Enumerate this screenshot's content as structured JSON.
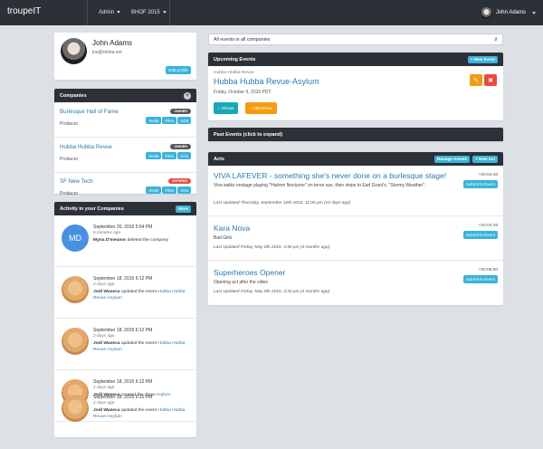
{
  "nav": {
    "brand": "troupeIT",
    "menu1": "Admin",
    "menu2": "BHOF 2015",
    "user": "John Adams"
  },
  "profile": {
    "name": "John Adams",
    "email": "jna@retina.net",
    "edit": "Edit profile"
  },
  "companies": {
    "title": "Companies",
    "items": [
      {
        "name": "Burlesque Hall of Fame",
        "role": "Producer",
        "badge": "OWNER",
        "badge_color": "#555555",
        "btn1": "Invite",
        "btn2": "Files",
        "btn3": "Acts"
      },
      {
        "name": "Hubba Hubba Revue",
        "role": "Producer",
        "badge": "OWNER",
        "badge_color": "#555555",
        "btn1": "Invite",
        "btn2": "Files",
        "btn3": "Acts"
      },
      {
        "name": "SF New Tech",
        "role": "Producer",
        "badge": "EXPIRED",
        "badge_color": "#e74c3c",
        "btn1": "Invite",
        "btn2": "Files",
        "btn3": "Acts"
      }
    ]
  },
  "activity": {
    "title": "Activity in your Companies",
    "more": "More",
    "items": [
      {
        "initials": "MD",
        "timestamp": "September 20, 2015 5:54 PM",
        "ago": "8 minutes ago",
        "actor": "Myna D'meanor",
        "action": " deleted the company",
        "link": ""
      },
      {
        "initials": "",
        "timestamp": "September 18, 2015 6:12 PM",
        "ago": "2 days ago",
        "actor": "Jodi Waseca",
        "action": " updated the event ",
        "link": "Hubba Hubba Revue-Asylum"
      },
      {
        "initials": "",
        "timestamp": "September 18, 2015 6:12 PM",
        "ago": "2 days ago",
        "actor": "Jodi Waseca",
        "action": " updated the event ",
        "link": "Hubba Hubba Revue-Asylum"
      },
      {
        "initials": "",
        "timestamp": "September 18, 2015 6:12 PM",
        "ago": "2 days ago",
        "actor": "Jodi Waseca",
        "action": " created the show ",
        "link": "Asylum"
      },
      {
        "initials": "",
        "timestamp": "September 18, 2015 6:10 PM",
        "ago": "2 days ago",
        "actor": "Jodi Waseca",
        "action": " updated the event ",
        "link": "Hubba Hubba Revue-Asylum"
      }
    ]
  },
  "filter": {
    "selected": "All events in all companies"
  },
  "upcoming": {
    "title": "Upcoming Events",
    "new_event": "+ New Event",
    "company": "Hubba Hubba Revue",
    "event": "Hubba Hubba Revue-Asylum",
    "date": "Friday, October 9, 2015 PDT",
    "shows": "Shows",
    "add_show": "+ Add Show"
  },
  "past": {
    "title": "Past Events (click to expand)"
  },
  "acts": {
    "title": "Acts",
    "manage_assets": "Manage Assets",
    "new_act": "+ New Act",
    "submit": "Submit to Event",
    "items": [
      {
        "title": "VIVA LAFEVER - something she's never done on a burlesque stage!",
        "desc": "Viva walks onstage playing \"Harlem Nocturne\" on tenor sax, then strips to Earl Grant's, \"Stormy Weather\".",
        "duration": "+00:02:46",
        "updated": "Last Updated Thursday, September 10th 2015, 11:06 pm (10 days ago)"
      },
      {
        "title": "Kara Nova",
        "desc": "Bad Girls",
        "duration": "+00:03:48",
        "updated": "Last Updated Friday, May 8th 2015, 4:58 pm (4 months ago)"
      },
      {
        "title": "Superheroes Opener",
        "desc": "Opening act after the video",
        "duration": "+00:05:00",
        "updated": "Last Updated Friday, May 8th 2015, 3:34 pm (4 months ago)"
      }
    ]
  }
}
